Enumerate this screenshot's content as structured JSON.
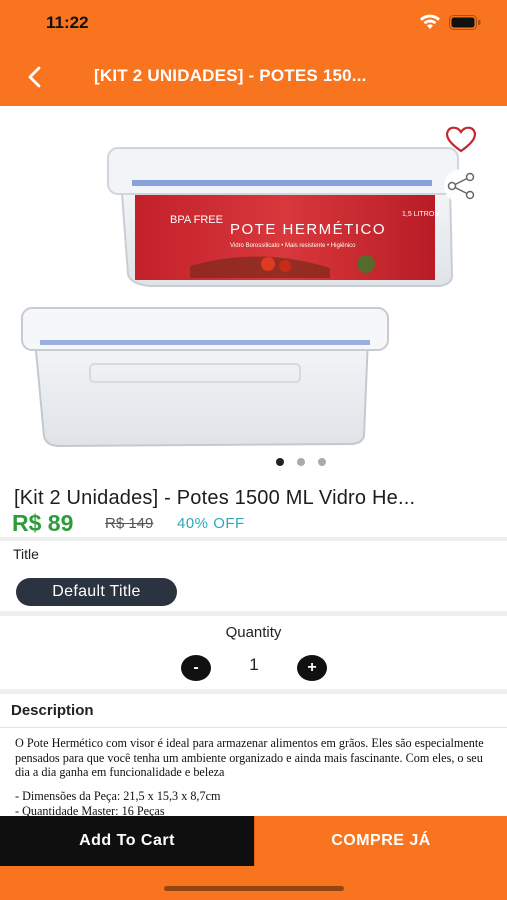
{
  "status_bar": {
    "time": "11:22"
  },
  "nav": {
    "title": "[KIT 2 UNIDADES] - POTES 150..."
  },
  "gallery": {
    "label_title": "POTE HERMÉTICO",
    "label_subtitle": "Vidro Borossilicato • Mais resistente • Higiênico",
    "badge_left": "BPA FREE",
    "badge_right": "1,5 LITROS",
    "dots_total": 3,
    "dots_active": 1
  },
  "product": {
    "name": "[Kit 2 Unidades] - Potes 1500 ML Vidro He...",
    "price": "R$ 89",
    "old_price": "R$ 149",
    "discount": "40% OFF"
  },
  "variant": {
    "label": "Title",
    "selected": "Default Title"
  },
  "quantity": {
    "label": "Quantity",
    "minus": "-",
    "value": "1",
    "plus": "+"
  },
  "description": {
    "title": "Description",
    "body": "O Pote Hermético com visor é ideal para armazenar alimentos em grãos. Eles são especialmente pensados para que você tenha um ambiente organizado e ainda mais fascinante. Com eles, o seu dia a dia ganha em funcionalidade e beleza",
    "items": [
      "- Dimensões da Peça: 21,5 x 15,3 x 8,7cm",
      "- Quantidade Master: 16 Peças"
    ]
  },
  "footer": {
    "add_to_cart": "Add To Cart",
    "buy_now": "COMPRE JÁ"
  },
  "colors": {
    "brand_orange": "#f9741e",
    "price_green": "#2e9c3a",
    "discount_teal": "#2ea8b8",
    "chip_dark": "#2b3340",
    "cart_black": "#0f0f0f"
  },
  "icons": {
    "back": "chevron-left-icon",
    "favorite": "heart-icon",
    "share": "share-icon",
    "wifi": "wifi-icon",
    "battery": "battery-icon"
  }
}
